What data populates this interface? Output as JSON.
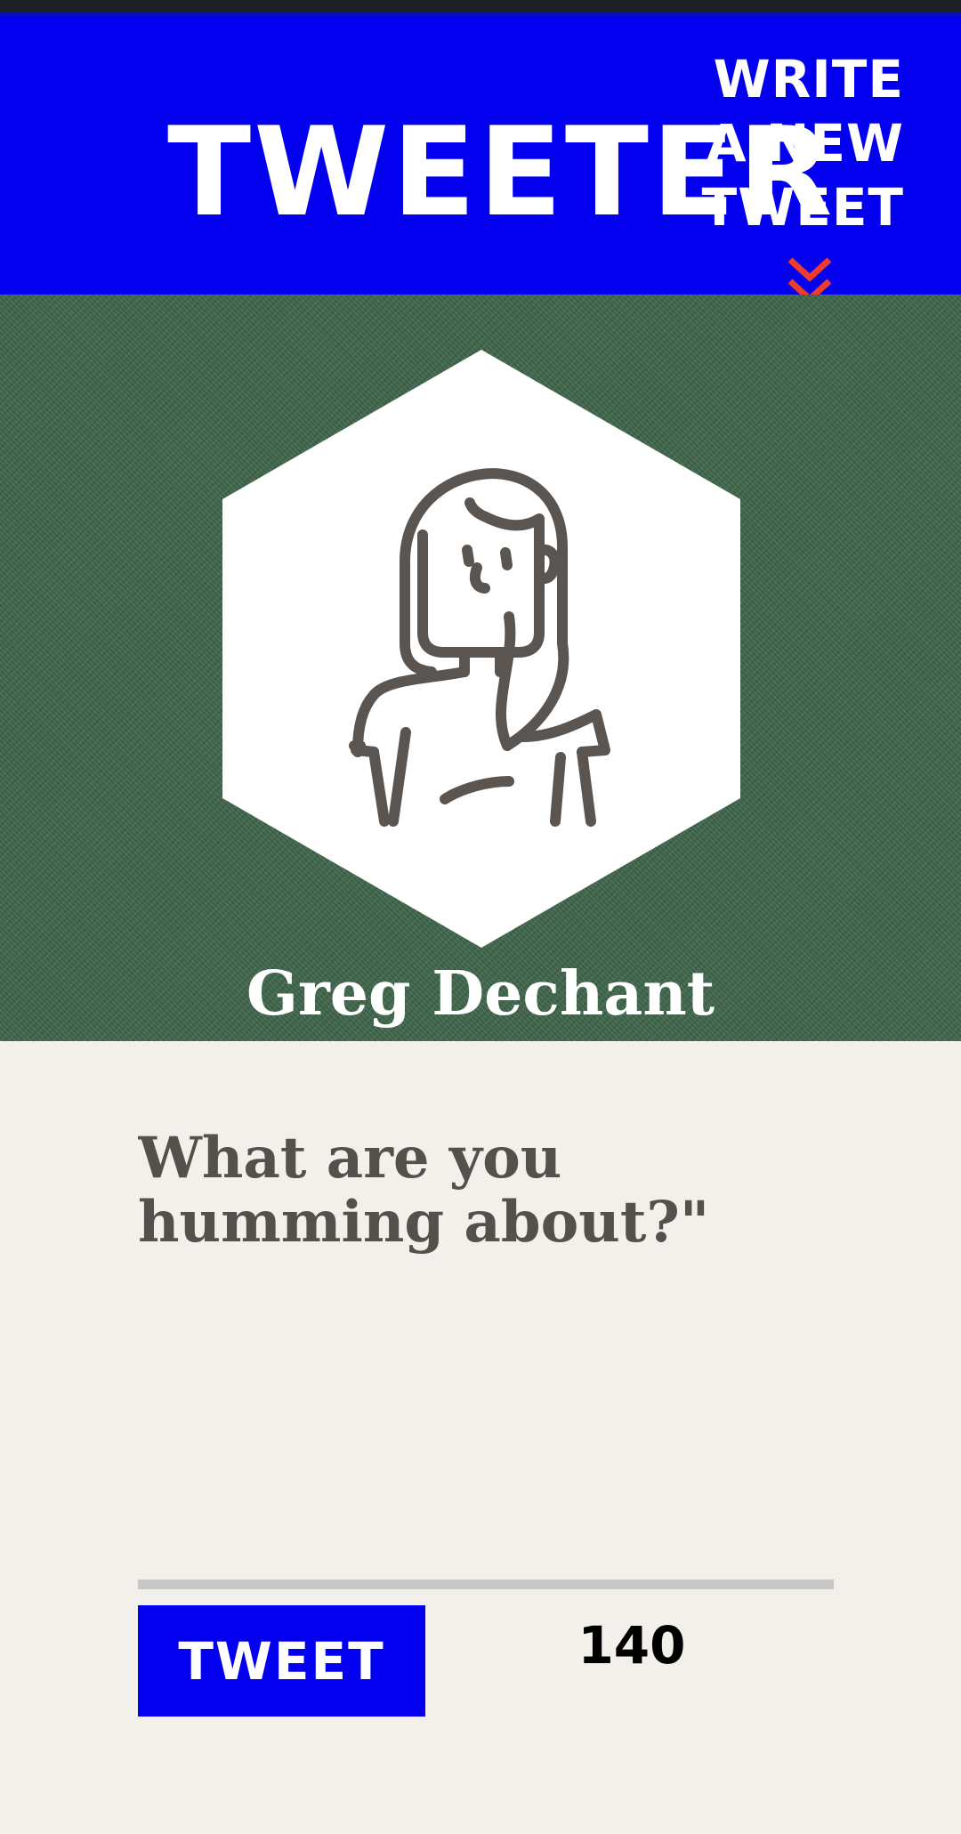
{
  "nav": {
    "brand": "TWEETER",
    "compose_lines": [
      "WRITE",
      "A NEW",
      "TWEET"
    ],
    "compose_icon": "double-chevron-down-icon"
  },
  "profile": {
    "name": "Greg Dechant",
    "avatar_icon": "user-avatar-icon"
  },
  "composer": {
    "placeholder": "What are you humming about?\"",
    "value": "",
    "submit_label": "TWEET",
    "char_count": "140"
  },
  "colors": {
    "nav_bg": "#0200ef",
    "accent_chevron": "#ef3b2c",
    "profile_bg": "#3e654a",
    "page_bg": "#f3f0ec",
    "placeholder_text": "#55504c"
  }
}
